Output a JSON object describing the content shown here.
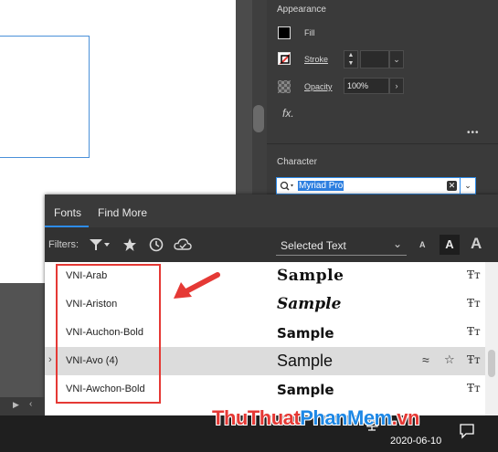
{
  "appearance": {
    "title": "Appearance",
    "fill_label": "Fill",
    "stroke_label": "Stroke",
    "opacity_label": "Opacity",
    "opacity_value": "100%",
    "fx_label": "fx.",
    "more_label": "•••"
  },
  "character": {
    "title": "Character",
    "font_value": "Myriad Pro"
  },
  "font_panel": {
    "tabs": [
      "Fonts",
      "Find More"
    ],
    "filters_label": "Filters:",
    "preview_select": "Selected Text",
    "size_small": "A",
    "size_medium": "A",
    "size_large": "A",
    "fonts": [
      {
        "name": "VNI-Arab",
        "sample": "Sample"
      },
      {
        "name": "VNI-Ariston",
        "sample": "Sample"
      },
      {
        "name": "VNI-Auchon-Bold",
        "sample": "Sample"
      },
      {
        "name": "VNI-Avo (4)",
        "sample": "Sample"
      },
      {
        "name": "VNI-Awchon-Bold",
        "sample": "Sample"
      }
    ]
  },
  "watermark": {
    "part1": "ThuThuat",
    "part2": "PhanMem",
    "part3": ".vn"
  },
  "taskbar": {
    "date": "2020-06-10"
  },
  "colors": {
    "accent": "#2d8ceb",
    "annotation": "#e53935",
    "watermark_red": "#e53935",
    "watermark_blue": "#1e88e5"
  }
}
